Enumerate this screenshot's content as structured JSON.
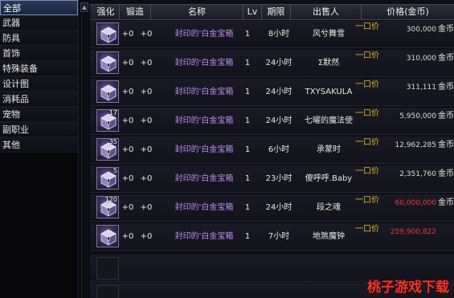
{
  "categories": [
    {
      "label": "全部",
      "active": true
    },
    {
      "label": "武器",
      "active": false
    },
    {
      "label": "防具",
      "active": false
    },
    {
      "label": "首饰",
      "active": false
    },
    {
      "label": "特殊装备",
      "active": false
    },
    {
      "label": "设计图",
      "active": false
    },
    {
      "label": "消耗品",
      "active": false
    },
    {
      "label": "宠物",
      "active": false
    },
    {
      "label": "副职业",
      "active": false
    },
    {
      "label": "其他",
      "active": false
    }
  ],
  "scroll_up_glyph": "▲",
  "table": {
    "columns": {
      "refine": "强化",
      "forge": "锻造",
      "name": "名称",
      "lv": "Lv",
      "period": "期限",
      "seller": "出售人",
      "price": "价格(金币)"
    },
    "rows": [
      {
        "qty": "",
        "refine": "+0",
        "forge": "+0",
        "name": "封印的'白金宝箱",
        "lv": "1",
        "period": "8小时",
        "seller": "风兮舞雪",
        "type": "一口价",
        "price": "300,000",
        "currency": "金币",
        "price_red": false
      },
      {
        "qty": "",
        "refine": "+0",
        "forge": "+0",
        "name": "封印的'白金宝箱",
        "lv": "1",
        "period": "24小时",
        "seller": "Σ默然",
        "type": "一口价",
        "price": "310,000",
        "currency": "金币",
        "price_red": false
      },
      {
        "qty": "",
        "refine": "+0",
        "forge": "+0",
        "name": "封印的'白金宝箱",
        "lv": "1",
        "period": "24小时",
        "seller": "TXYSAKULA",
        "type": "一口价",
        "price": "311,111",
        "currency": "金币",
        "price_red": false
      },
      {
        "qty": "17",
        "refine": "+0",
        "forge": "+0",
        "name": "封印的'白金宝箱",
        "lv": "1",
        "period": "24小时",
        "seller": "七曜的魔法使",
        "type": "一口价",
        "price": "5,950,000",
        "currency": "金币",
        "price_red": false
      },
      {
        "qty": "35",
        "refine": "+0",
        "forge": "+0",
        "name": "封印的'白金宝箱",
        "lv": "1",
        "period": "6小时",
        "seller": "承蒙时",
        "type": "一口价",
        "price": "12,962,285",
        "currency": "金币",
        "price_red": false
      },
      {
        "qty": "5",
        "refine": "+0",
        "forge": "+0",
        "name": "封印的'白金宝箱",
        "lv": "1",
        "period": "23小时",
        "seller": "傻呼呼.Baby",
        "type": "一口价",
        "price": "2,351,760",
        "currency": "金币",
        "price_red": false
      },
      {
        "qty": "120",
        "refine": "+0",
        "forge": "+0",
        "name": "封印的'白金宝箱",
        "lv": "1",
        "period": "24小时",
        "seller": "段之魂",
        "type": "一口价",
        "price": "60,000,000",
        "currency": "金币",
        "price_red": true
      },
      {
        "qty": "",
        "refine": "+0",
        "forge": "+0",
        "name": "封印的'白金宝箱",
        "lv": "1",
        "period": "7小时",
        "seller": "地煞魔钟",
        "type": "一口价",
        "price": "259,900,822",
        "currency": "",
        "price_red": true
      }
    ]
  },
  "watermark": "桃子游戏下载",
  "colors": {
    "item_name": "#b98fe6",
    "buy_now_label": "#e0b52a",
    "high_price": "#e53a3a",
    "watermark": "#e63a30"
  }
}
